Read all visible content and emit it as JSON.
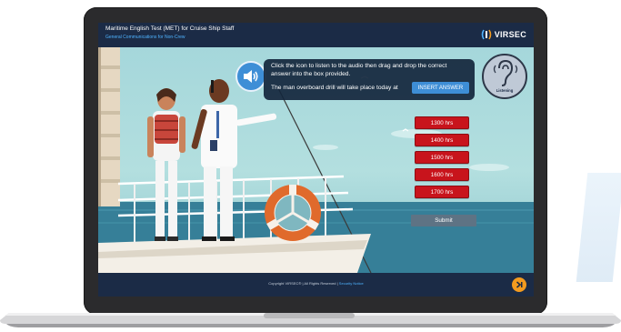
{
  "app": {
    "title": "Maritime English Test (MET) for Cruise Ship Staff",
    "subtitle": "General Communications for Non-Crew",
    "brand": "VIRSEC"
  },
  "question": {
    "instruction": "Click the icon to listen to the audio then drag and drop the correct answer into the box provided.",
    "sentence": "The man overboard drill will take place today at",
    "drop_target_label": "INSERT ANSWER"
  },
  "listening_badge": {
    "label": "Listening"
  },
  "options": [
    "1300 hrs",
    "1400 hrs",
    "1500 hrs",
    "1600 hrs",
    "1700 hrs"
  ],
  "submit_label": "Submit",
  "footer": {
    "copyright": "Copyright VIRSEC® | All Rights Reserved |",
    "privacy_link": "Security Notice"
  },
  "colors": {
    "header_bg": "#1b2b46",
    "option_bg": "#c8141c",
    "accent_blue": "#3e8ed6",
    "next_button": "#f39b1f",
    "submit_bg": "#5e7384"
  },
  "icons": {
    "audio": "speaker-icon",
    "listening": "ear-icon",
    "next": "next-arrow-icon",
    "brand": "virsec-logo-icon"
  }
}
